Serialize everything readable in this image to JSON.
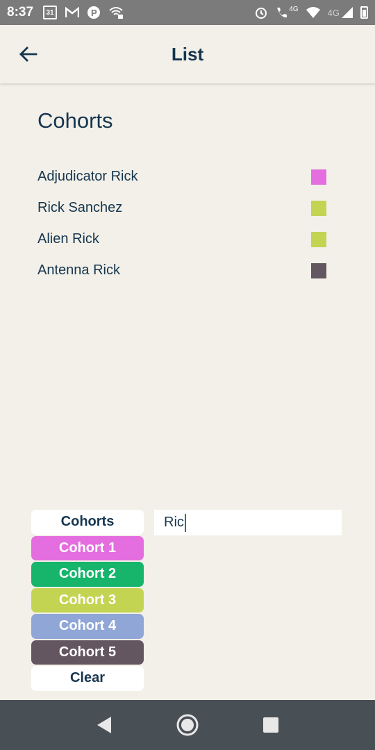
{
  "status_bar": {
    "time": "8:37",
    "calendar_day": "31",
    "signal_label_1": "4G",
    "signal_label_2": "4G"
  },
  "app_bar": {
    "title": "List"
  },
  "section": {
    "title": "Cohorts"
  },
  "cohorts": [
    {
      "name": "Adjudicator Rick",
      "color": "#e46ddf"
    },
    {
      "name": "Rick Sanchez",
      "color": "#c3d452"
    },
    {
      "name": "Alien Rick",
      "color": "#c3d452"
    },
    {
      "name": "Antenna Rick",
      "color": "#635661"
    }
  ],
  "filters": {
    "header_label": "Cohorts",
    "buttons": [
      {
        "label": "Cohort 1",
        "color": "#e46ddf"
      },
      {
        "label": "Cohort 2",
        "color": "#17b46c"
      },
      {
        "label": "Cohort 3",
        "color": "#c3d452"
      },
      {
        "label": "Cohort 4",
        "color": "#8fa6d6"
      },
      {
        "label": "Cohort 5",
        "color": "#635661"
      }
    ],
    "clear_label": "Clear"
  },
  "search": {
    "value": "Ric"
  }
}
